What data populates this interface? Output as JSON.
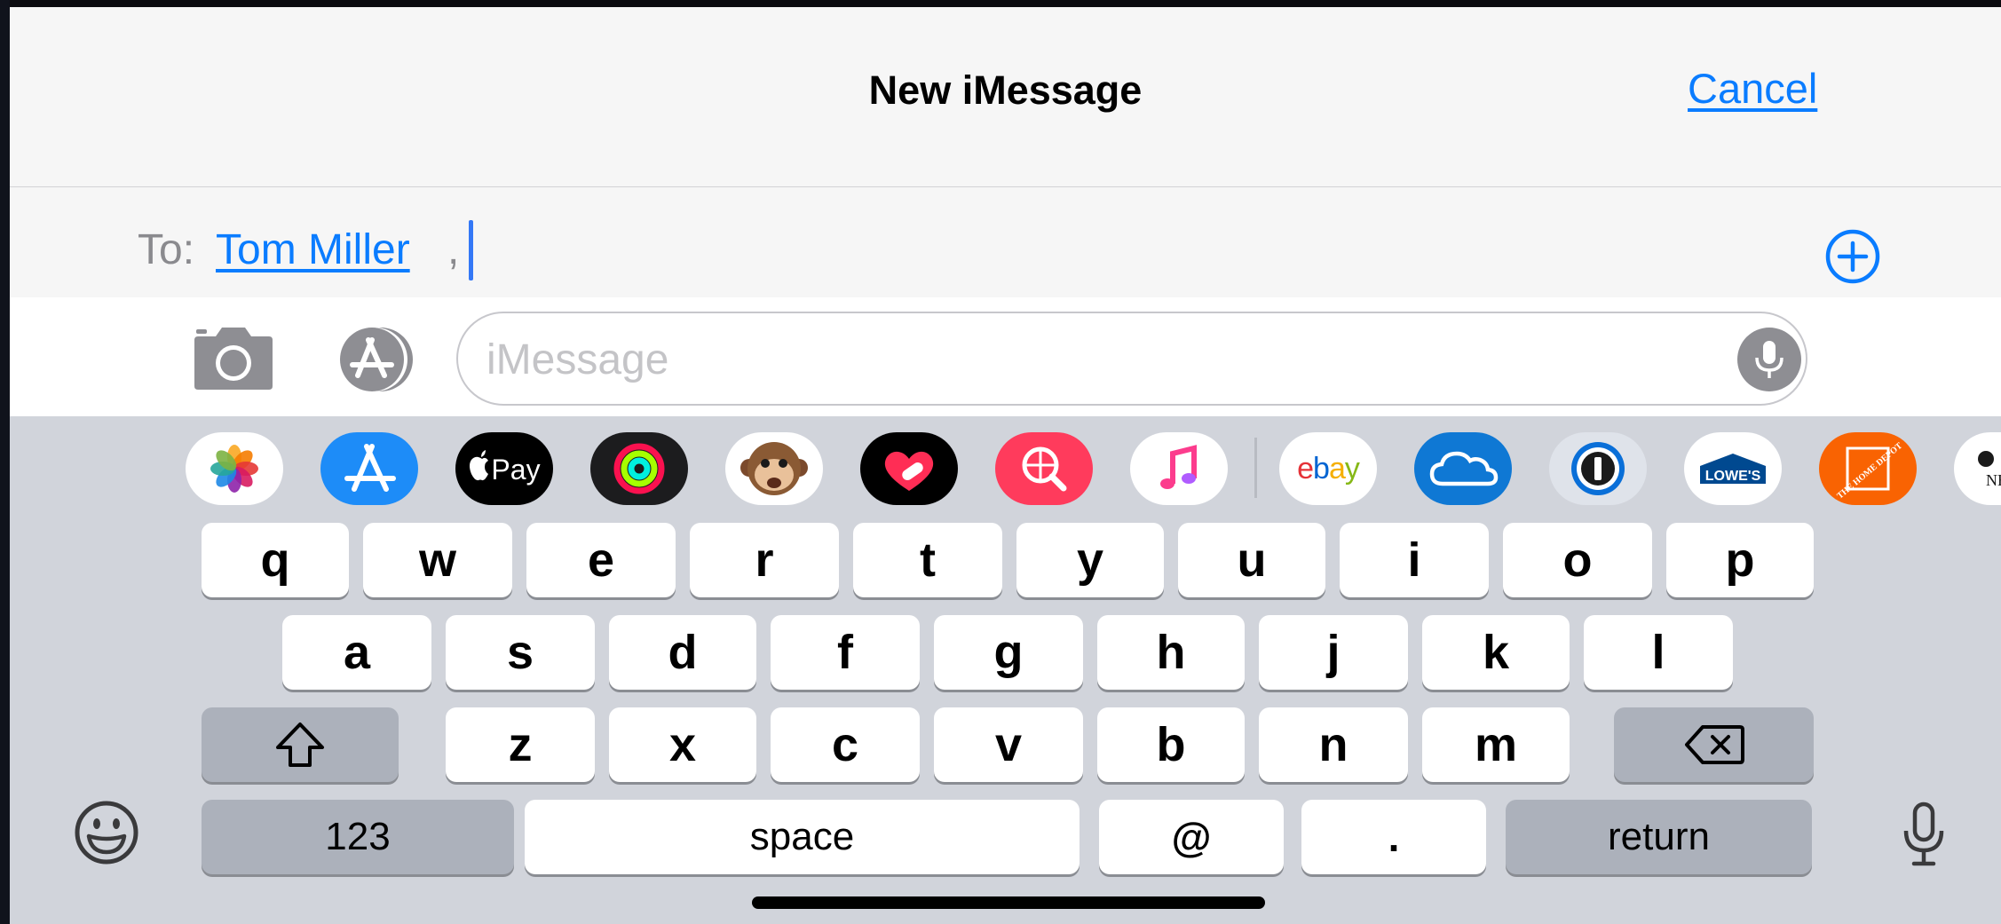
{
  "navbar": {
    "title": "New iMessage",
    "cancel_label": "Cancel"
  },
  "recipients": {
    "to_label": "To:",
    "chips": [
      "Tom Miller"
    ],
    "separator": ","
  },
  "compose": {
    "placeholder": "iMessage"
  },
  "app_drawer": [
    {
      "name": "photos",
      "icon": "photos-icon"
    },
    {
      "name": "app-store",
      "icon": "app-store-icon"
    },
    {
      "name": "apple-pay",
      "icon": "apple-pay-icon",
      "text": "Pay"
    },
    {
      "name": "activity",
      "icon": "activity-rings-icon"
    },
    {
      "name": "animoji",
      "icon": "monkey-animoji-icon"
    },
    {
      "name": "digital-touch",
      "icon": "heart-touch-icon"
    },
    {
      "name": "images-search",
      "icon": "globe-search-icon"
    },
    {
      "name": "music",
      "icon": "music-note-icon"
    },
    {
      "name": "ebay",
      "icon": "ebay-logo",
      "text": "ebay"
    },
    {
      "name": "onedrive",
      "icon": "cloud-icon"
    },
    {
      "name": "1password",
      "icon": "1password-icon"
    },
    {
      "name": "lowes",
      "icon": "lowes-logo",
      "text": "LOWE'S"
    },
    {
      "name": "home-depot",
      "icon": "home-depot-logo",
      "text": "THE HOME DEPOT"
    },
    {
      "name": "nbc",
      "icon": "nbc-logo",
      "text": "NB"
    }
  ],
  "keyboard": {
    "row1": [
      "q",
      "w",
      "e",
      "r",
      "t",
      "y",
      "u",
      "i",
      "o",
      "p"
    ],
    "row2": [
      "a",
      "s",
      "d",
      "f",
      "g",
      "h",
      "j",
      "k",
      "l"
    ],
    "row3": [
      "z",
      "x",
      "c",
      "v",
      "b",
      "n",
      "m"
    ],
    "numbers_label": "123",
    "space_label": "space",
    "at_label": "@",
    "period_label": ".",
    "return_label": "return",
    "shift_icon": "shift-icon",
    "delete_icon": "delete-icon",
    "emoji_icon": "emoji-icon",
    "dictation_icon": "microphone-icon"
  },
  "colors": {
    "accent": "#0a7cff",
    "keyboard_bg": "#d1d4db",
    "func_key": "#acb1bb",
    "key": "#ffffff"
  }
}
